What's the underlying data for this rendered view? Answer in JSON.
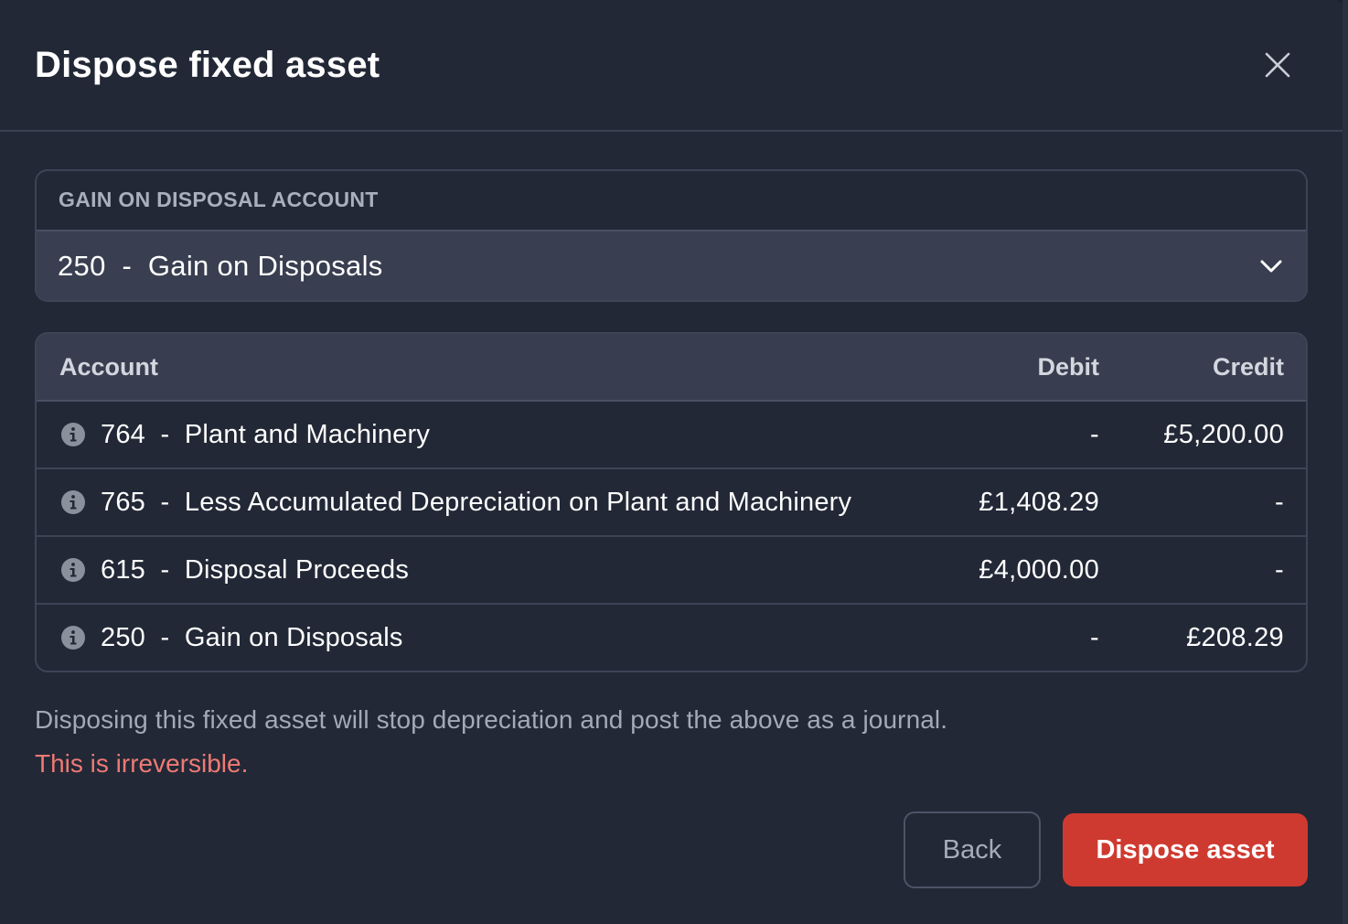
{
  "dialog": {
    "title": "Dispose fixed asset",
    "close_icon": "close-icon"
  },
  "gain_account": {
    "label": "GAIN ON DISPOSAL ACCOUNT",
    "selected": "250  -  Gain on Disposals",
    "dropdown_icon": "chevron-down-icon"
  },
  "journal_table": {
    "headers": {
      "account": "Account",
      "debit": "Debit",
      "credit": "Credit"
    },
    "rows": [
      {
        "account": "764  -  Plant and Machinery",
        "debit": "-",
        "credit": "£5,200.00",
        "icon": "info-icon"
      },
      {
        "account": "765  -  Less Accumulated Depreciation on Plant and Machinery",
        "debit": "£1,408.29",
        "credit": "-",
        "icon": "info-icon"
      },
      {
        "account": "615  -  Disposal Proceeds",
        "debit": "£4,000.00",
        "credit": "-",
        "icon": "info-icon"
      },
      {
        "account": "250  -  Gain on Disposals",
        "debit": "-",
        "credit": "£208.29",
        "icon": "info-icon"
      }
    ]
  },
  "notice": {
    "description": "Disposing this fixed asset will stop depreciation and post the above as a journal.",
    "warning": "This is irreversible."
  },
  "actions": {
    "back_label": "Back",
    "dispose_label": "Dispose asset"
  },
  "colors": {
    "background": "#222836",
    "warning": "#ef7a74",
    "primary_danger": "#cf3a30"
  }
}
